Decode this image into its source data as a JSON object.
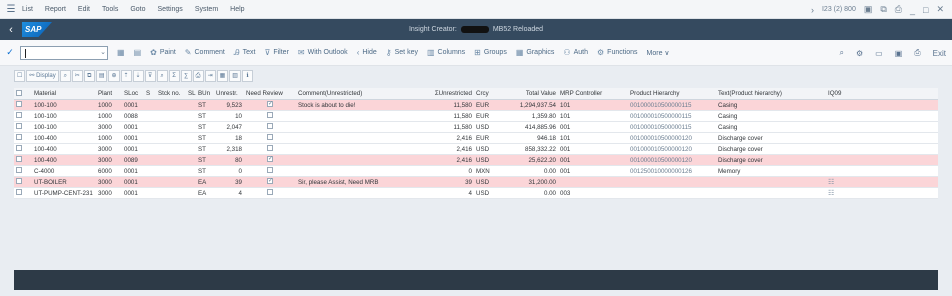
{
  "menu": {
    "items": [
      "List",
      "Report",
      "Edit",
      "Tools",
      "Goto",
      "Settings",
      "System",
      "Help"
    ],
    "right_session": "I23 (2) 800"
  },
  "shell": {
    "logo": "SAP",
    "title_prefix": "Insight Creator:",
    "title_suffix": "MB52 Reloaded"
  },
  "toolbar": {
    "buttons": [
      {
        "icon": "paint-icon",
        "glyph": "✿",
        "label": "Paint"
      },
      {
        "icon": "comment-icon",
        "glyph": "✎",
        "label": "Comment"
      },
      {
        "icon": "text-icon",
        "glyph": "Ꭿ",
        "label": "Text"
      },
      {
        "icon": "filter-icon",
        "glyph": "⊽",
        "label": "Filter"
      },
      {
        "icon": "mail-icon",
        "glyph": "✉",
        "label": "With Outlook"
      },
      {
        "icon": "hide-icon",
        "glyph": "‹",
        "label": "Hide"
      },
      {
        "icon": "key-icon",
        "glyph": "⚷",
        "label": "Set key"
      },
      {
        "icon": "columns-icon",
        "glyph": "▥",
        "label": "Columns"
      },
      {
        "icon": "groups-icon",
        "glyph": "⊞",
        "label": "Groups"
      },
      {
        "icon": "graphics-icon",
        "glyph": "▦",
        "label": "Graphics"
      },
      {
        "icon": "auth-icon",
        "glyph": "⚇",
        "label": "Auth"
      },
      {
        "icon": "functions-icon",
        "glyph": "⚙",
        "label": "Functions"
      },
      {
        "icon": "more-icon",
        "glyph": "",
        "label": "More ∨"
      }
    ],
    "exit_label": "Exit"
  },
  "alv": {
    "display_label": "Display"
  },
  "table": {
    "headers": {
      "material": "Material",
      "plant": "Plant",
      "sloc": "SLoc",
      "s": "S",
      "stock_no": "Stck no.",
      "sl": "SL",
      "bun": "BUn",
      "unrestr": "Unrestr.",
      "need_review": "Need Review",
      "comment": "Comment(Unrestricted)",
      "unv": "ΣUnrestricted",
      "crcy": "Crcy",
      "total_value": "Total Value",
      "mrp": "MRP Controller",
      "ph": "Product Hierarchy",
      "txt": "Text(Product hierarchy)",
      "iq": "IQ09"
    },
    "rows": [
      {
        "pink": true,
        "material": "100-100",
        "plant": "1000",
        "sloc": "0001",
        "bun": "ST",
        "unrestr": "9,523",
        "need_review": true,
        "comment": "Stock is about to die!",
        "unv": "11,580",
        "crcy": "EUR",
        "total_value": "1,294,937.54",
        "mrp": "101",
        "ph": "001000010500000115",
        "txt": "Casing",
        "iq": ""
      },
      {
        "pink": false,
        "material": "100-100",
        "plant": "1000",
        "sloc": "0088",
        "bun": "ST",
        "unrestr": "10",
        "need_review": false,
        "comment": "",
        "unv": "11,580",
        "crcy": "EUR",
        "total_value": "1,359.80",
        "mrp": "101",
        "ph": "001000010500000115",
        "txt": "Casing",
        "iq": ""
      },
      {
        "pink": false,
        "material": "100-100",
        "plant": "3000",
        "sloc": "0001",
        "bun": "ST",
        "unrestr": "2,047",
        "need_review": false,
        "comment": "",
        "unv": "11,580",
        "crcy": "USD",
        "total_value": "414,885.96",
        "mrp": "001",
        "ph": "001000010500000115",
        "txt": "Casing",
        "iq": ""
      },
      {
        "pink": false,
        "material": "100-400",
        "plant": "1000",
        "sloc": "0001",
        "bun": "ST",
        "unrestr": "18",
        "need_review": false,
        "comment": "",
        "unv": "2,416",
        "crcy": "EUR",
        "total_value": "946.18",
        "mrp": "101",
        "ph": "001000010500000120",
        "txt": "Discharge cover",
        "iq": ""
      },
      {
        "pink": false,
        "material": "100-400",
        "plant": "3000",
        "sloc": "0001",
        "bun": "ST",
        "unrestr": "2,318",
        "need_review": false,
        "comment": "",
        "unv": "2,416",
        "crcy": "USD",
        "total_value": "858,332.22",
        "mrp": "001",
        "ph": "001000010500000120",
        "txt": "Discharge cover",
        "iq": ""
      },
      {
        "pink": true,
        "material": "100-400",
        "plant": "3000",
        "sloc": "0089",
        "bun": "ST",
        "unrestr": "80",
        "need_review": true,
        "comment": "",
        "unv": "2,416",
        "crcy": "USD",
        "total_value": "25,622.20",
        "mrp": "001",
        "ph": "001000010500000120",
        "txt": "Discharge cover",
        "iq": ""
      },
      {
        "pink": false,
        "material": "C-4000",
        "plant": "6000",
        "sloc": "0001",
        "bun": "ST",
        "unrestr": "0",
        "need_review": false,
        "comment": "",
        "unv": "0",
        "crcy": "MXN",
        "total_value": "0.00",
        "mrp": "001",
        "ph": "001250010000000126",
        "txt": "Memory",
        "iq": ""
      },
      {
        "pink": true,
        "material": "UT-BOILER",
        "plant": "3000",
        "sloc": "0001",
        "bun": "EA",
        "unrestr": "39",
        "need_review": true,
        "comment": "Sir, please Assist, Need MRB",
        "unv": "39",
        "crcy": "USD",
        "total_value": "31,200.00",
        "mrp": "",
        "ph": "",
        "txt": "",
        "iq": "☷"
      },
      {
        "pink": false,
        "material": "UT-PUMP-CENT-231",
        "plant": "3000",
        "sloc": "0001",
        "bun": "EA",
        "unrestr": "4",
        "need_review": false,
        "comment": "",
        "unv": "4",
        "crcy": "USD",
        "total_value": "0.00",
        "mrp": "003",
        "ph": "",
        "txt": "",
        "iq": "☷"
      }
    ]
  }
}
